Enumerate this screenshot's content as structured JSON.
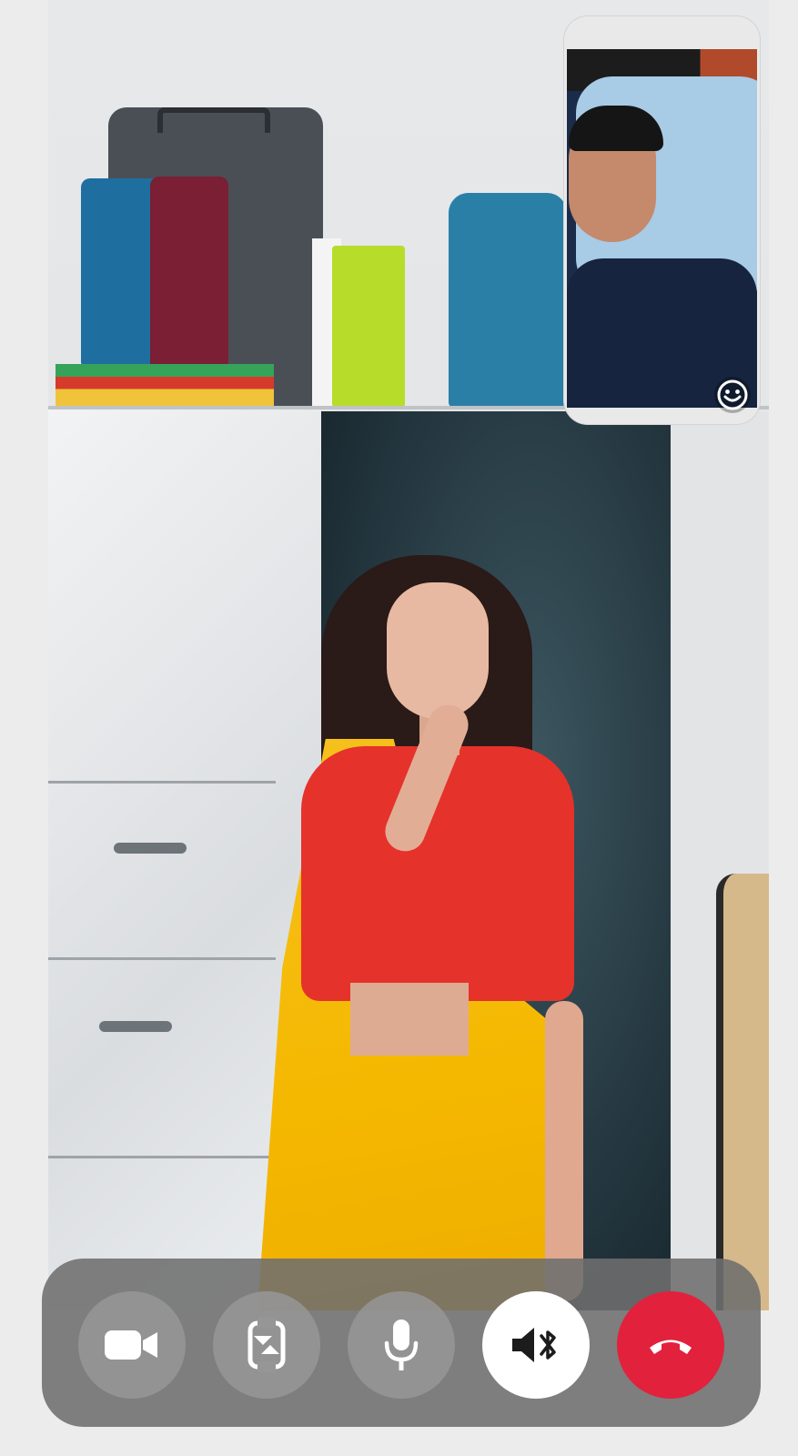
{
  "call": {
    "remote_video": {
      "description_key": "remote-participant-video"
    },
    "self_view": {
      "emoji_icon": "smiley-face-icon"
    },
    "controls": [
      {
        "id": "video",
        "icon": "video-camera-icon",
        "state": "on"
      },
      {
        "id": "flip",
        "icon": "switch-camera-icon",
        "state": "available"
      },
      {
        "id": "mic",
        "icon": "microphone-icon",
        "state": "on"
      },
      {
        "id": "speaker",
        "icon": "bluetooth-speaker-icon",
        "state": "active"
      },
      {
        "id": "end",
        "icon": "end-call-icon",
        "state": "available"
      }
    ],
    "colors": {
      "end_call": "#e2213d",
      "active_button": "#ffffff",
      "inactive_button": "#969696",
      "control_bar": "#6e6e6e"
    }
  }
}
